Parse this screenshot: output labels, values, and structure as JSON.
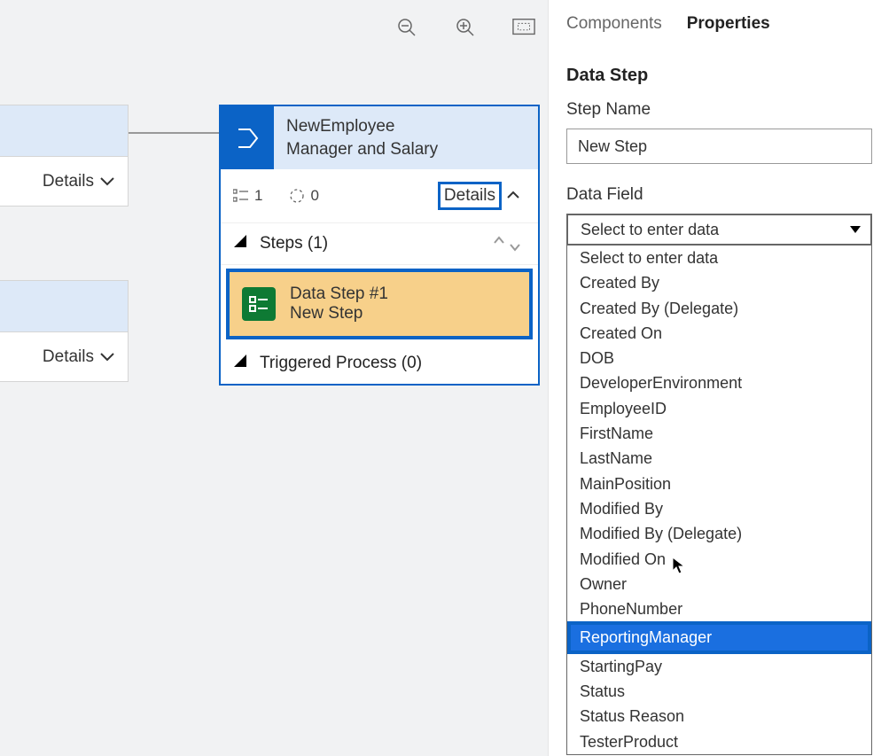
{
  "canvas": {
    "side_card_details": "Details",
    "stage": {
      "title_line1": "NewEmployee",
      "title_line2": "Manager and Salary",
      "meta_count1": "1",
      "meta_count2": "0",
      "details_label": "Details",
      "steps_header": "Steps (1)",
      "step1_title": "Data Step #1",
      "step1_subtitle": "New Step",
      "triggered_header": "Triggered Process (0)"
    }
  },
  "panel": {
    "tabs": {
      "components": "Components",
      "properties": "Properties"
    },
    "section_title": "Data Step",
    "step_name_label": "Step Name",
    "step_name_value": "New Step",
    "data_field_label": "Data Field",
    "data_field_placeholder": "Select to enter data",
    "options": [
      "Select to enter data",
      "Created By",
      "Created By (Delegate)",
      "Created On",
      "DOB",
      "DeveloperEnvironment",
      "EmployeeID",
      "FirstName",
      "LastName",
      "MainPosition",
      "Modified By",
      "Modified By (Delegate)",
      "Modified On",
      "Owner",
      "PhoneNumber",
      "ReportingManager",
      "StartingPay",
      "Status",
      "Status Reason",
      "TesterProduct"
    ],
    "selected_index": 15
  }
}
